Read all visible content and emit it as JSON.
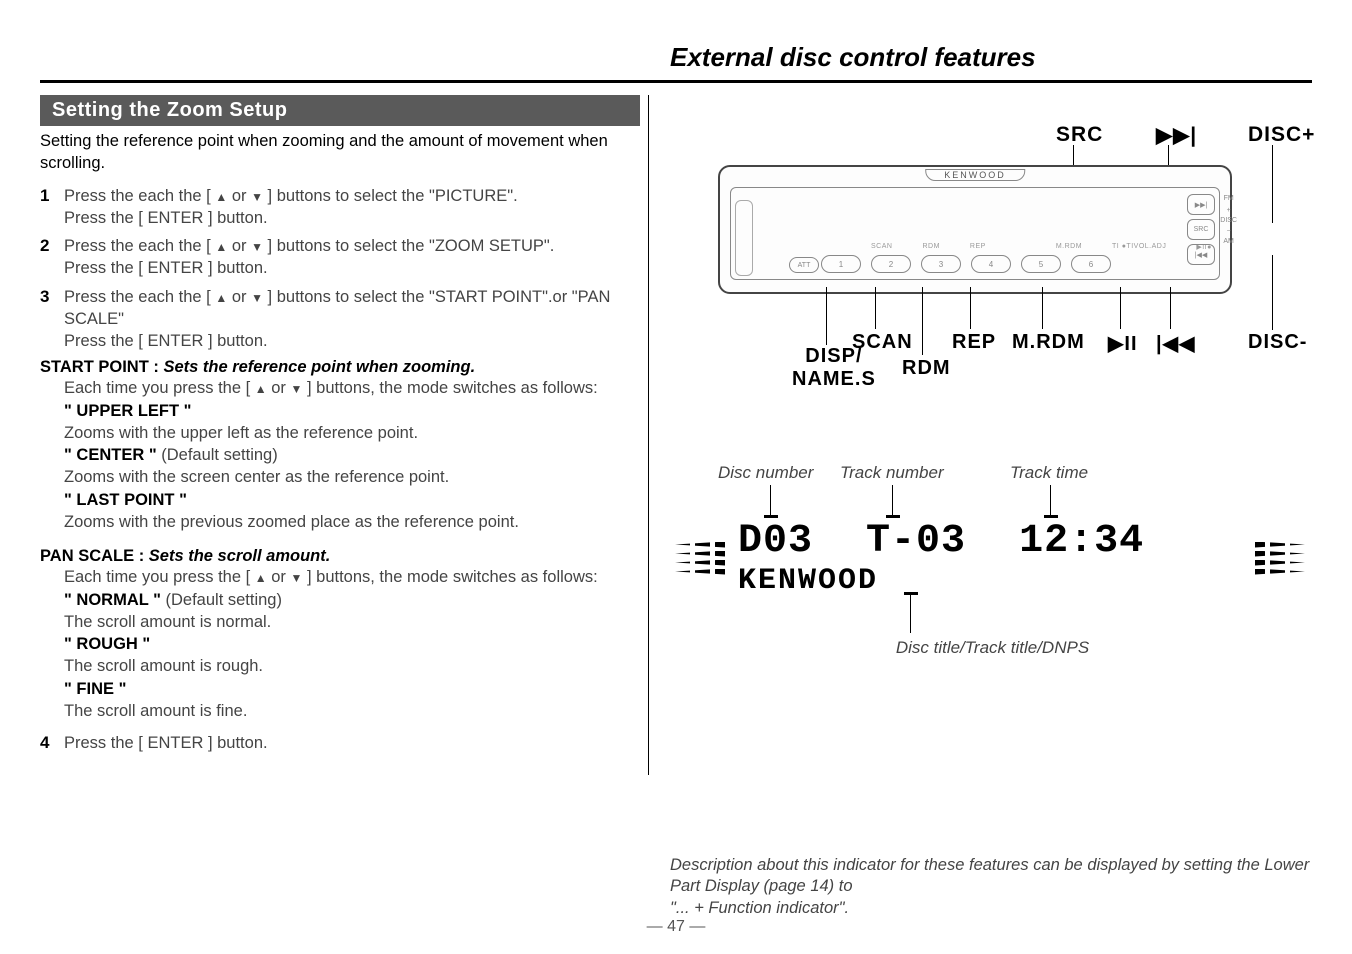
{
  "page": {
    "section_title": "External disc control features",
    "page_number": "— 47 —"
  },
  "left": {
    "heading": "Setting the Zoom Setup",
    "intro": "Setting the reference point when zooming and the amount of movement when scrolling.",
    "steps": {
      "s1a": "Press the each the [ ",
      "s1b": "  or  ",
      "s1c": " ] buttons to select the \"PICTURE\".",
      "s1d": "Press the [ ENTER ] button.",
      "s2a": "Press the each the [ ",
      "s2b": "  or  ",
      "s2c": " ] buttons to select the \"ZOOM SETUP\".",
      "s2d": "Press the [ ENTER ] button.",
      "s3a": "Press the each the [ ",
      "s3b": "  or  ",
      "s3c": " ] buttons to select the \"START POINT\".or \"PAN SCALE\"",
      "s3d": "Press the [ ENTER ] button.",
      "s4": "Press the [ ENTER ] button."
    },
    "start_point": {
      "title_prefix": "START POINT : ",
      "title_ital": "Sets the reference point when zooming.",
      "lead_a": "Each time you press the [ ",
      "lead_b": "  or  ",
      "lead_c": " ] buttons, the mode switches as follows:",
      "opt1": "\" UPPER LEFT \"",
      "opt1_desc": "Zooms with the upper left as the reference point.",
      "opt2": "\" CENTER \"",
      "opt2_note": " (Default setting)",
      "opt2_desc": "Zooms with the screen center as the reference point.",
      "opt3": "\" LAST POINT \"",
      "opt3_desc": "Zooms with the previous zoomed place as the reference point."
    },
    "pan_scale": {
      "title_prefix": "PAN SCALE : ",
      "title_ital": "Sets the scroll amount.",
      "lead_a": "Each time you press the [ ",
      "lead_b": "  or  ",
      "lead_c": " ] buttons, the mode switches as follows:",
      "opt1": "\" NORMAL \"",
      "opt1_note": " (Default setting)",
      "opt1_desc": "The scroll amount is normal.",
      "opt2": "\" ROUGH \"",
      "opt2_desc": "The scroll amount is rough.",
      "opt3": "\" FINE \"",
      "opt3_desc": "The scroll amount is fine."
    }
  },
  "device": {
    "labels_top": {
      "src": "SRC",
      "ffwd": "▶▶|",
      "disc_plus": "DISC+"
    },
    "labels_bottom": {
      "disp": "DISP/\nNAME.S",
      "scan": "SCAN",
      "rdm": "RDM",
      "rep": "REP",
      "mrdm": "M.RDM",
      "playpause": "▶II",
      "rew": "|◀◀",
      "disc_minus": "DISC-"
    },
    "brand": "KENWOOD",
    "mini": {
      "scan": "SCAN",
      "rdm": "RDM",
      "rep": "REP",
      "mrdm": "M.RDM",
      "ti": "TI ●TIVOL.ADJ",
      "play": "▶II●"
    },
    "att": "ATT",
    "presets": [
      "1",
      "2",
      "3",
      "4",
      "5",
      "6"
    ],
    "side": {
      "src": "SRC",
      "fm": "FM",
      "disc": "DISC",
      "am": "AM"
    }
  },
  "display": {
    "top_labels": {
      "disc": "Disc number",
      "track": "Track number",
      "time": "Track time"
    },
    "row1": {
      "disc": "D03",
      "track": "T-03",
      "time": "12:34"
    },
    "row2": "KENWOOD",
    "bottom_label": "Disc title/Track title/DNPS"
  },
  "footnote": {
    "l1": "Description about this indicator for these features can be displayed by setting the Lower Part Display (page 14) to",
    "l2": "\"... + Function indicator\"."
  }
}
